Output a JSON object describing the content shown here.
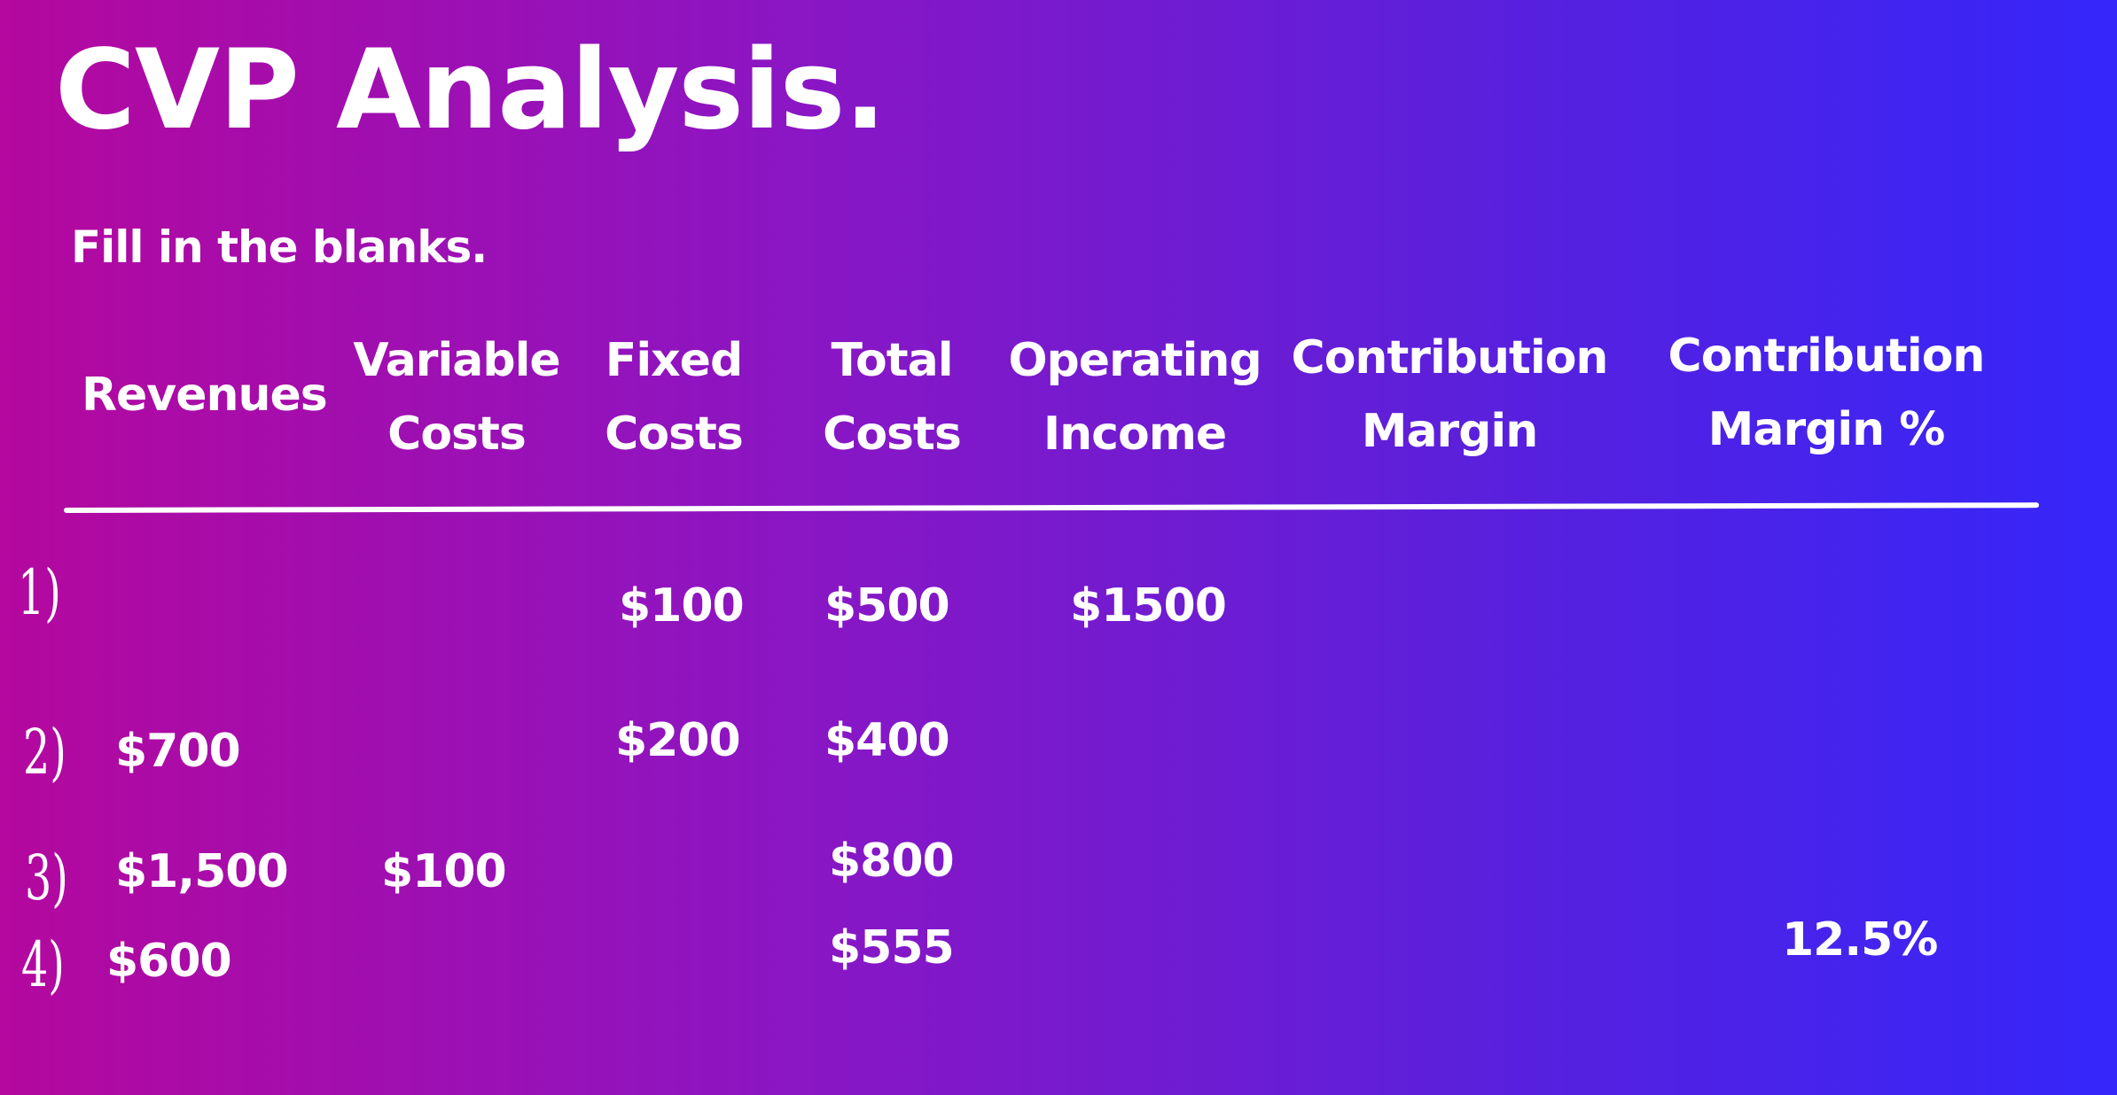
{
  "title": "CVP Analysis.",
  "subtitle": "Fill in the blanks.",
  "headers": {
    "revenues": "Revenues",
    "variable_costs": [
      "Variable",
      "Costs"
    ],
    "fixed_costs": [
      "Fixed",
      "Costs"
    ],
    "total_costs": [
      "Total",
      "Costs"
    ],
    "operating_income": [
      "Operating",
      "Income"
    ],
    "contribution_margin": [
      "Contribution",
      "Margin"
    ],
    "contribution_margin_pct": [
      "Contribution",
      "Margin %"
    ]
  },
  "rows": [
    {
      "num": "1)",
      "fixed_costs": "$100",
      "total_costs": "$500",
      "operating_income": "$1500"
    },
    {
      "num": "2)",
      "revenues": "$700",
      "fixed_costs": "$200",
      "total_costs": "$400"
    },
    {
      "num": "3)",
      "revenues": "$1,500",
      "variable_costs": "$100",
      "total_costs": "$800"
    },
    {
      "num": "4)",
      "revenues": "$600",
      "total_costs": "$555",
      "contribution_margin_pct": "12.5%"
    }
  ]
}
